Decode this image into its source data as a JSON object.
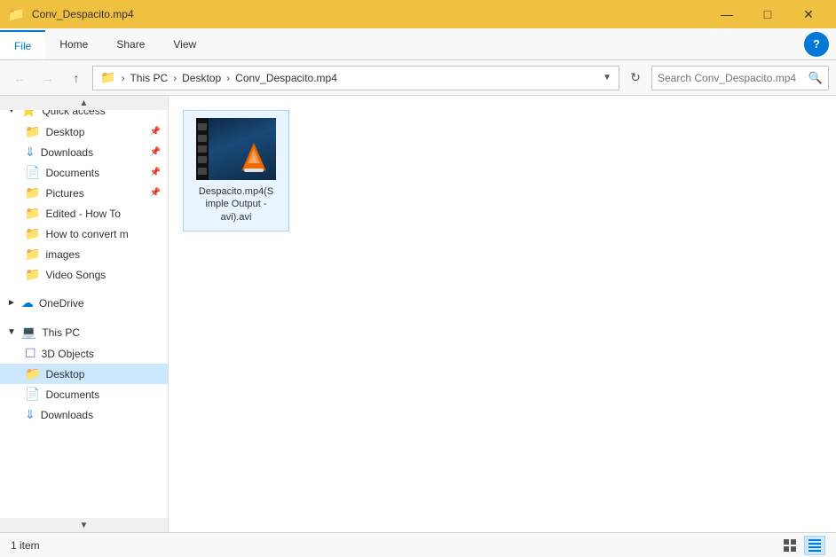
{
  "titlebar": {
    "title": "Conv_Despacito.mp4",
    "minimize_label": "—",
    "maximize_label": "□",
    "close_label": "✕"
  },
  "ribbon": {
    "tabs": [
      {
        "id": "file",
        "label": "File",
        "active": true
      },
      {
        "id": "home",
        "label": "Home",
        "active": false
      },
      {
        "id": "share",
        "label": "Share",
        "active": false
      },
      {
        "id": "view",
        "label": "View",
        "active": false
      }
    ],
    "help_label": "?"
  },
  "addressbar": {
    "back_tooltip": "Back",
    "forward_tooltip": "Forward",
    "up_tooltip": "Up",
    "breadcrumb": [
      {
        "label": "This PC"
      },
      {
        "label": "Desktop"
      },
      {
        "label": "Conv_Despacito.mp4"
      }
    ],
    "search_placeholder": "Search Conv_Despacito.mp4"
  },
  "sidebar": {
    "quick_access_label": "Quick access",
    "items_quick": [
      {
        "id": "desktop",
        "label": "Desktop",
        "pinned": true,
        "active": false,
        "type": "folder-blue"
      },
      {
        "id": "downloads",
        "label": "Downloads",
        "pinned": true,
        "active": false,
        "type": "download"
      },
      {
        "id": "documents",
        "label": "Documents",
        "pinned": true,
        "active": false,
        "type": "docs"
      },
      {
        "id": "pictures",
        "label": "Pictures",
        "pinned": true,
        "active": false,
        "type": "folder-blue"
      },
      {
        "id": "edited",
        "label": "Edited - How To",
        "pinned": false,
        "active": false,
        "type": "folder-yellow"
      },
      {
        "id": "howto",
        "label": "How to convert m",
        "pinned": false,
        "active": false,
        "type": "folder-yellow"
      },
      {
        "id": "images",
        "label": "images",
        "pinned": false,
        "active": false,
        "type": "folder-yellow"
      },
      {
        "id": "videosongs",
        "label": "Video Songs",
        "pinned": false,
        "active": false,
        "type": "folder-yellow"
      }
    ],
    "onedrive_label": "OneDrive",
    "this_pc_label": "This PC",
    "items_pc": [
      {
        "id": "3dobjects",
        "label": "3D Objects",
        "active": false,
        "type": "3dobjects"
      },
      {
        "id": "desktop2",
        "label": "Desktop",
        "active": true,
        "type": "folder-blue"
      },
      {
        "id": "documents2",
        "label": "Documents",
        "active": false,
        "type": "docs"
      },
      {
        "id": "downloads2",
        "label": "Downloads",
        "active": false,
        "type": "download"
      }
    ]
  },
  "content": {
    "file": {
      "name": "Despacito.mp4(Simple Output - avi).avi",
      "label_line1": "Despacito.mp4(S",
      "label_line2": "imple Output -",
      "label_line3": "avi).avi"
    }
  },
  "statusbar": {
    "count_text": "1 item",
    "view_icons_tooltip": "Medium icons",
    "view_list_tooltip": "Details"
  }
}
